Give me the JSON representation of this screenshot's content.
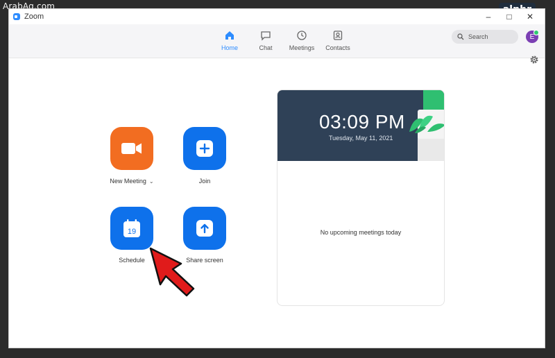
{
  "watermarks": {
    "left": "ArabAq.com",
    "right": "alphr"
  },
  "window": {
    "title": "Zoom",
    "controls": [
      "–",
      "□",
      "✕"
    ]
  },
  "nav": {
    "items": [
      {
        "label": "Home",
        "icon": "home-icon",
        "active": true
      },
      {
        "label": "Chat",
        "icon": "chat-icon",
        "active": false
      },
      {
        "label": "Meetings",
        "icon": "clock-icon",
        "active": false
      },
      {
        "label": "Contacts",
        "icon": "contacts-icon",
        "active": false
      }
    ],
    "search_placeholder": "Search",
    "avatar_initial": "E"
  },
  "actions": {
    "new_meeting": "New Meeting",
    "join": "Join",
    "schedule": "Schedule",
    "schedule_day": "19",
    "share_screen": "Share screen"
  },
  "panel": {
    "time": "03:09 PM",
    "date": "Tuesday, May 11, 2021",
    "empty_message": "No upcoming meetings today"
  },
  "colors": {
    "accent": "#2d8cff",
    "orange_tile": "#f26d21",
    "blue_tile": "#0e71eb",
    "header_bg": "#2f4157",
    "arrow": "#e01b1b"
  }
}
